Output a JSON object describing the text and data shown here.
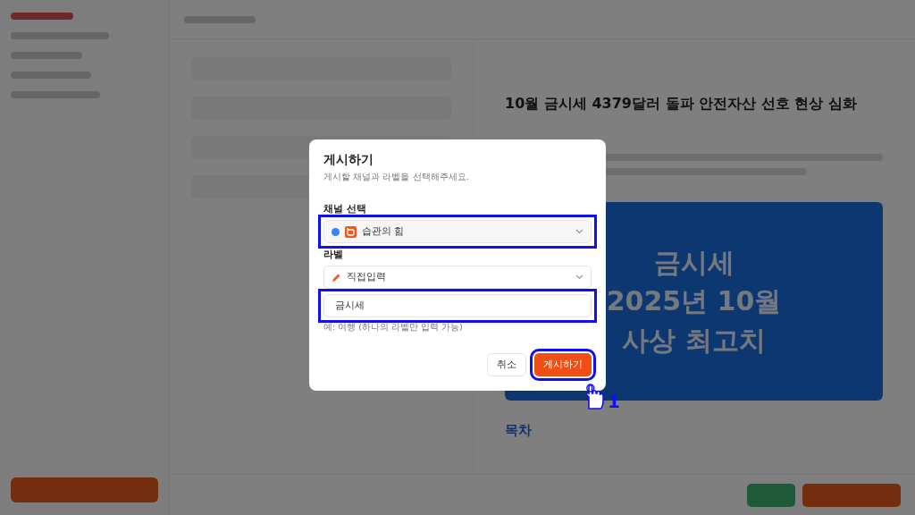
{
  "background": {
    "article_title": "10월 금시세 4379달러 돌파 안전자산 선호 현상 심화",
    "banner_lines": [
      "금시세",
      "2025년 10월",
      "사상 최고치"
    ],
    "toc_heading": "목차"
  },
  "dialog": {
    "title": "게시하기",
    "subtitle": "게시할 채널과 라벨을 선택해주세요.",
    "channel": {
      "label": "채널 선택",
      "value": "습관의 힘",
      "highlighted": true
    },
    "label": {
      "label": "라벨",
      "value": "직접입력"
    },
    "label_input": {
      "value": "금시세",
      "highlighted": true
    },
    "hint": "예: 여행 (하나의 라벨만 입력 가능)",
    "buttons": [
      {
        "label": "취소",
        "kind": "secondary",
        "highlighted": false
      },
      {
        "label": "게시하기",
        "kind": "primary",
        "highlighted": true
      }
    ],
    "step": "1"
  }
}
